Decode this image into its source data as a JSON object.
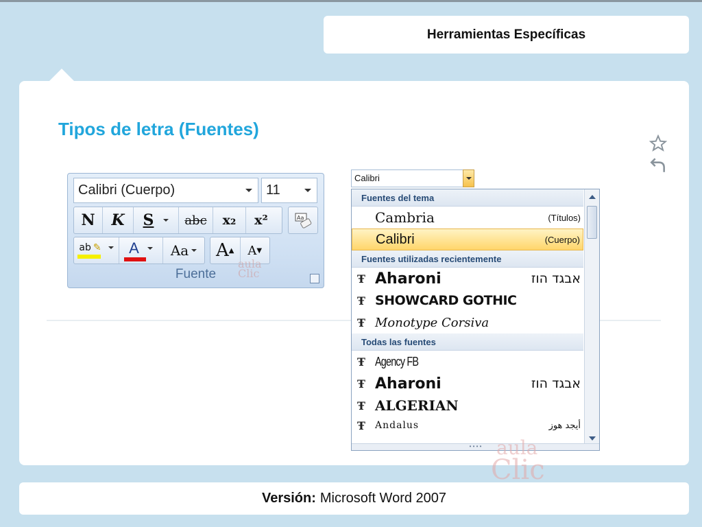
{
  "header": {
    "title": "Herramientas Específicas"
  },
  "main": {
    "title": "Tipos de letra (Fuentes)"
  },
  "ribbon": {
    "font_name": "Calibri (Cuerpo)",
    "font_size": "11",
    "group_label": "Fuente",
    "buttons_row1": [
      {
        "icon": "bold-icon",
        "label": "N"
      },
      {
        "icon": "italic-icon",
        "label": "K"
      },
      {
        "icon": "underline-icon",
        "label": "S"
      },
      {
        "icon": "strikethrough-icon",
        "label": "abc"
      },
      {
        "icon": "subscript-icon",
        "label": "x₂"
      },
      {
        "icon": "superscript-icon",
        "label": "x²"
      }
    ],
    "buttons_row2": [
      {
        "icon": "highlight-icon",
        "label": "ab"
      },
      {
        "icon": "font-color-icon",
        "label": "A"
      },
      {
        "icon": "change-case-icon",
        "label": "Aa"
      },
      {
        "icon": "grow-font-icon",
        "label": "A"
      },
      {
        "icon": "shrink-font-icon",
        "label": "A"
      }
    ],
    "highlight_color": "#f5f000",
    "font_color": "#e01010"
  },
  "dropdown": {
    "selected": "Calibri",
    "sections": {
      "theme": "Fuentes del tema",
      "recent": "Fuentes utilizadas recientemente",
      "all": "Todas las fuentes"
    },
    "theme_fonts": [
      {
        "name": "Cambria",
        "tag": "(Títulos)"
      },
      {
        "name": "Calibri",
        "tag": "(Cuerpo)"
      }
    ],
    "recent_fonts": [
      {
        "name": "Aharoni",
        "sample": "אבגד הוז"
      },
      {
        "name": "SHOWCARD GOTHIC",
        "sample": ""
      },
      {
        "name": "Monotype Corsiva",
        "sample": ""
      }
    ],
    "all_fonts": [
      {
        "name": "Agency FB",
        "sample": ""
      },
      {
        "name": "Aharoni",
        "sample": "אבגד הוז"
      },
      {
        "name": "ALGERIAN",
        "sample": ""
      },
      {
        "name": "Andalus",
        "sample": "أيجد هوز"
      }
    ]
  },
  "watermark": {
    "line1": "aula",
    "line2": "Clic"
  },
  "footer": {
    "label": "Versión:",
    "value": "Microsoft Word 2007"
  },
  "colors": {
    "background": "#c7e0ee",
    "title": "#21a6dc",
    "selected_item": "#ffd66b"
  }
}
